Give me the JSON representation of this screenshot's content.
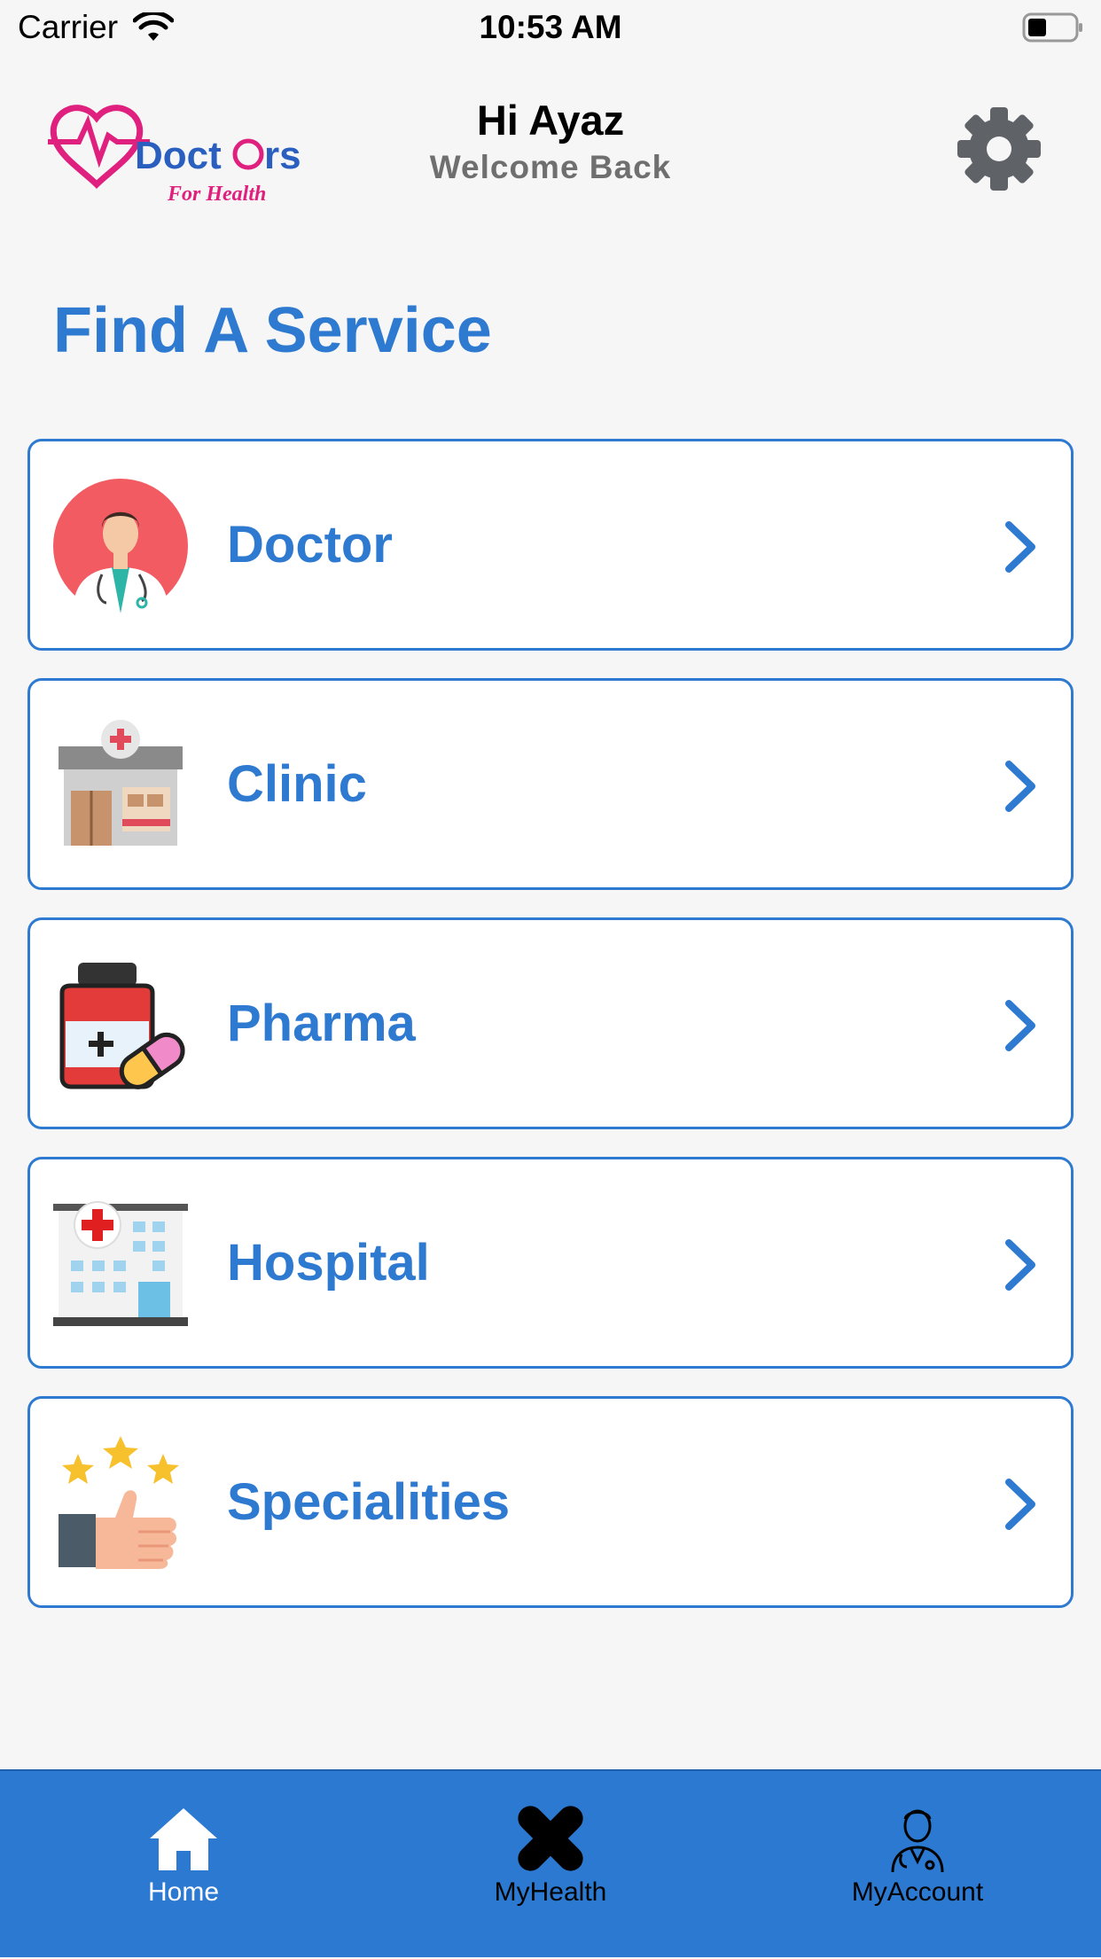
{
  "status_bar": {
    "carrier": "Carrier",
    "time": "10:53 AM"
  },
  "header": {
    "logo_alt": "Doctors For Health",
    "greeting": "Hi Ayaz",
    "subtitle": "Welcome Back",
    "settings_icon": "gear-icon"
  },
  "page_title": "Find A Service",
  "services": [
    {
      "label": "Doctor",
      "icon": "doctor-avatar-icon"
    },
    {
      "label": "Clinic",
      "icon": "clinic-building-icon"
    },
    {
      "label": "Pharma",
      "icon": "medicine-bottle-icon"
    },
    {
      "label": "Hospital",
      "icon": "hospital-building-icon"
    },
    {
      "label": "Specialities",
      "icon": "thumbs-up-stars-icon"
    }
  ],
  "tabs": [
    {
      "label": "Home",
      "icon": "home-icon",
      "active": true
    },
    {
      "label": "MyHealth",
      "icon": "bandage-icon",
      "active": false
    },
    {
      "label": "MyAccount",
      "icon": "doctor-person-icon",
      "active": false
    }
  ],
  "colors": {
    "accent": "#2f7ad1",
    "tab_bar": "#2b79d1",
    "background": "#f6f6f6"
  }
}
